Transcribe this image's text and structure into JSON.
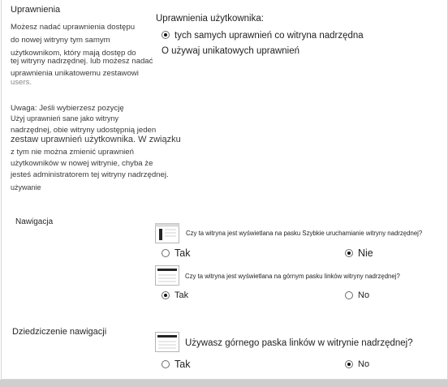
{
  "permissions": {
    "title": "Uprawnienia",
    "desc_lines": [
      "Możesz nadać uprawnienia dostępu",
      "do nowej witryny tym samym",
      "użytkownikom, który mają dostęp do",
      "tej witryny nadrzędnej. lub możesz nadać",
      "uprawnienia unikatowemu zestawowi"
    ],
    "desc_faded": "users.",
    "note_lines": [
      "Uwaga: Jeśli wybierzesz pozycję",
      "Użyj uprawnień sane jako witryny",
      "nadrzędnej, obie witryny udostępnią jeden",
      "zestaw uprawnień użytkownika. W związku",
      "z tym nie można zmienić uprawnień",
      "użytkowników w nowej witrynie, chyba że",
      "jesteś administratorem tej witryny nadrzędnej.",
      "używanie"
    ],
    "field_label": "Uprawnienia użytkownika:",
    "options": [
      {
        "label": "tych samych uprawnień co witryna nadrzędna",
        "checked": true
      },
      {
        "label": "O używaj unikatowych uprawnień",
        "checked": false
      }
    ]
  },
  "navigation": {
    "title": "Nawigacja",
    "q1": {
      "icon": "quick-launch-icon",
      "label": "Czy ta witryna jest wyświetlana na pasku Szybkie uruchamianie witryny nadrzędnej?",
      "yes": "Tak",
      "no": "Nie",
      "selected": "no"
    },
    "q2": {
      "icon": "top-link-bar-icon",
      "label": "Czy ta witryna jest wyświetlana na górnym pasku linków witryny nadrzędnej?",
      "yes": "Tak",
      "no": "No",
      "selected": "yes"
    }
  },
  "inheritance": {
    "title": "Dziedziczenie nawigacji",
    "q": {
      "icon": "top-link-bar-icon",
      "label": "Używasz górnego paska linków w witrynie nadrzędnej?",
      "yes": "Tak",
      "no": "No",
      "selected": "no"
    }
  }
}
